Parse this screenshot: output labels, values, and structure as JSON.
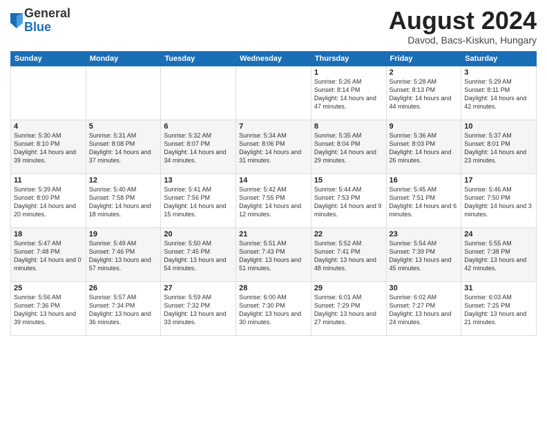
{
  "logo": {
    "general": "General",
    "blue": "Blue"
  },
  "header": {
    "month": "August 2024",
    "location": "Davod, Bacs-Kiskun, Hungary"
  },
  "days_of_week": [
    "Sunday",
    "Monday",
    "Tuesday",
    "Wednesday",
    "Thursday",
    "Friday",
    "Saturday"
  ],
  "weeks": [
    [
      {
        "day": "",
        "info": ""
      },
      {
        "day": "",
        "info": ""
      },
      {
        "day": "",
        "info": ""
      },
      {
        "day": "",
        "info": ""
      },
      {
        "day": "1",
        "info": "Sunrise: 5:26 AM\nSunset: 8:14 PM\nDaylight: 14 hours\nand 47 minutes."
      },
      {
        "day": "2",
        "info": "Sunrise: 5:28 AM\nSunset: 8:13 PM\nDaylight: 14 hours\nand 44 minutes."
      },
      {
        "day": "3",
        "info": "Sunrise: 5:29 AM\nSunset: 8:11 PM\nDaylight: 14 hours\nand 42 minutes."
      }
    ],
    [
      {
        "day": "4",
        "info": "Sunrise: 5:30 AM\nSunset: 8:10 PM\nDaylight: 14 hours\nand 39 minutes."
      },
      {
        "day": "5",
        "info": "Sunrise: 5:31 AM\nSunset: 8:08 PM\nDaylight: 14 hours\nand 37 minutes."
      },
      {
        "day": "6",
        "info": "Sunrise: 5:32 AM\nSunset: 8:07 PM\nDaylight: 14 hours\nand 34 minutes."
      },
      {
        "day": "7",
        "info": "Sunrise: 5:34 AM\nSunset: 8:06 PM\nDaylight: 14 hours\nand 31 minutes."
      },
      {
        "day": "8",
        "info": "Sunrise: 5:35 AM\nSunset: 8:04 PM\nDaylight: 14 hours\nand 29 minutes."
      },
      {
        "day": "9",
        "info": "Sunrise: 5:36 AM\nSunset: 8:03 PM\nDaylight: 14 hours\nand 26 minutes."
      },
      {
        "day": "10",
        "info": "Sunrise: 5:37 AM\nSunset: 8:01 PM\nDaylight: 14 hours\nand 23 minutes."
      }
    ],
    [
      {
        "day": "11",
        "info": "Sunrise: 5:39 AM\nSunset: 8:00 PM\nDaylight: 14 hours\nand 20 minutes."
      },
      {
        "day": "12",
        "info": "Sunrise: 5:40 AM\nSunset: 7:58 PM\nDaylight: 14 hours\nand 18 minutes."
      },
      {
        "day": "13",
        "info": "Sunrise: 5:41 AM\nSunset: 7:56 PM\nDaylight: 14 hours\nand 15 minutes."
      },
      {
        "day": "14",
        "info": "Sunrise: 5:42 AM\nSunset: 7:55 PM\nDaylight: 14 hours\nand 12 minutes."
      },
      {
        "day": "15",
        "info": "Sunrise: 5:44 AM\nSunset: 7:53 PM\nDaylight: 14 hours\nand 9 minutes."
      },
      {
        "day": "16",
        "info": "Sunrise: 5:45 AM\nSunset: 7:51 PM\nDaylight: 14 hours\nand 6 minutes."
      },
      {
        "day": "17",
        "info": "Sunrise: 5:46 AM\nSunset: 7:50 PM\nDaylight: 14 hours\nand 3 minutes."
      }
    ],
    [
      {
        "day": "18",
        "info": "Sunrise: 5:47 AM\nSunset: 7:48 PM\nDaylight: 14 hours\nand 0 minutes."
      },
      {
        "day": "19",
        "info": "Sunrise: 5:49 AM\nSunset: 7:46 PM\nDaylight: 13 hours\nand 57 minutes."
      },
      {
        "day": "20",
        "info": "Sunrise: 5:50 AM\nSunset: 7:45 PM\nDaylight: 13 hours\nand 54 minutes."
      },
      {
        "day": "21",
        "info": "Sunrise: 5:51 AM\nSunset: 7:43 PM\nDaylight: 13 hours\nand 51 minutes."
      },
      {
        "day": "22",
        "info": "Sunrise: 5:52 AM\nSunset: 7:41 PM\nDaylight: 13 hours\nand 48 minutes."
      },
      {
        "day": "23",
        "info": "Sunrise: 5:54 AM\nSunset: 7:39 PM\nDaylight: 13 hours\nand 45 minutes."
      },
      {
        "day": "24",
        "info": "Sunrise: 5:55 AM\nSunset: 7:38 PM\nDaylight: 13 hours\nand 42 minutes."
      }
    ],
    [
      {
        "day": "25",
        "info": "Sunrise: 5:56 AM\nSunset: 7:36 PM\nDaylight: 13 hours\nand 39 minutes."
      },
      {
        "day": "26",
        "info": "Sunrise: 5:57 AM\nSunset: 7:34 PM\nDaylight: 13 hours\nand 36 minutes."
      },
      {
        "day": "27",
        "info": "Sunrise: 5:59 AM\nSunset: 7:32 PM\nDaylight: 13 hours\nand 33 minutes."
      },
      {
        "day": "28",
        "info": "Sunrise: 6:00 AM\nSunset: 7:30 PM\nDaylight: 13 hours\nand 30 minutes."
      },
      {
        "day": "29",
        "info": "Sunrise: 6:01 AM\nSunset: 7:29 PM\nDaylight: 13 hours\nand 27 minutes."
      },
      {
        "day": "30",
        "info": "Sunrise: 6:02 AM\nSunset: 7:27 PM\nDaylight: 13 hours\nand 24 minutes."
      },
      {
        "day": "31",
        "info": "Sunrise: 6:03 AM\nSunset: 7:25 PM\nDaylight: 13 hours\nand 21 minutes."
      }
    ]
  ]
}
